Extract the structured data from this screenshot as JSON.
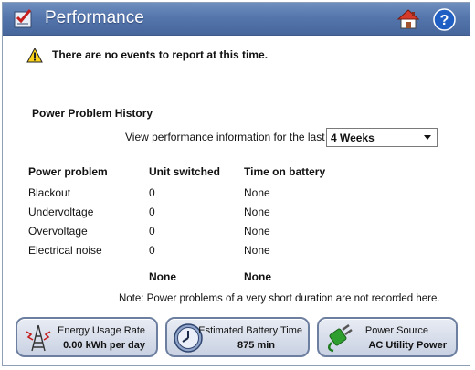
{
  "window": {
    "title": "Performance",
    "home_icon": "home-icon",
    "help_icon": "help-icon",
    "help_glyph": "?"
  },
  "alert": {
    "icon": "warning-icon",
    "text": "There are no events to report at this time."
  },
  "history": {
    "title": "Power Problem History",
    "period_label": "View performance information for the last",
    "period_value": "4 Weeks",
    "columns": [
      "Power problem",
      "Unit switched",
      "Time on battery"
    ],
    "rows": [
      {
        "problem": "Blackout",
        "switched": "0",
        "time": "None"
      },
      {
        "problem": "Undervoltage",
        "switched": "0",
        "time": "None"
      },
      {
        "problem": "Overvoltage",
        "switched": "0",
        "time": "None"
      },
      {
        "problem": "Electrical noise",
        "switched": "0",
        "time": "None"
      }
    ],
    "totals": {
      "switched": "None",
      "time": "None"
    },
    "note": "Note: Power problems of a very short duration are not recorded here."
  },
  "tiles": [
    {
      "label": "Energy Usage Rate",
      "value": "0.00 kWh per day",
      "icon": "power-tower-icon"
    },
    {
      "label": "Estimated Battery Time",
      "value": "875 min",
      "icon": "clock-icon"
    },
    {
      "label": "Power Source",
      "value": "AC Utility Power",
      "icon": "plug-icon"
    }
  ],
  "colors": {
    "titlebar": "#5576ac",
    "tile_border": "#6d7fa0",
    "plug_green": "#2e9e2e"
  }
}
